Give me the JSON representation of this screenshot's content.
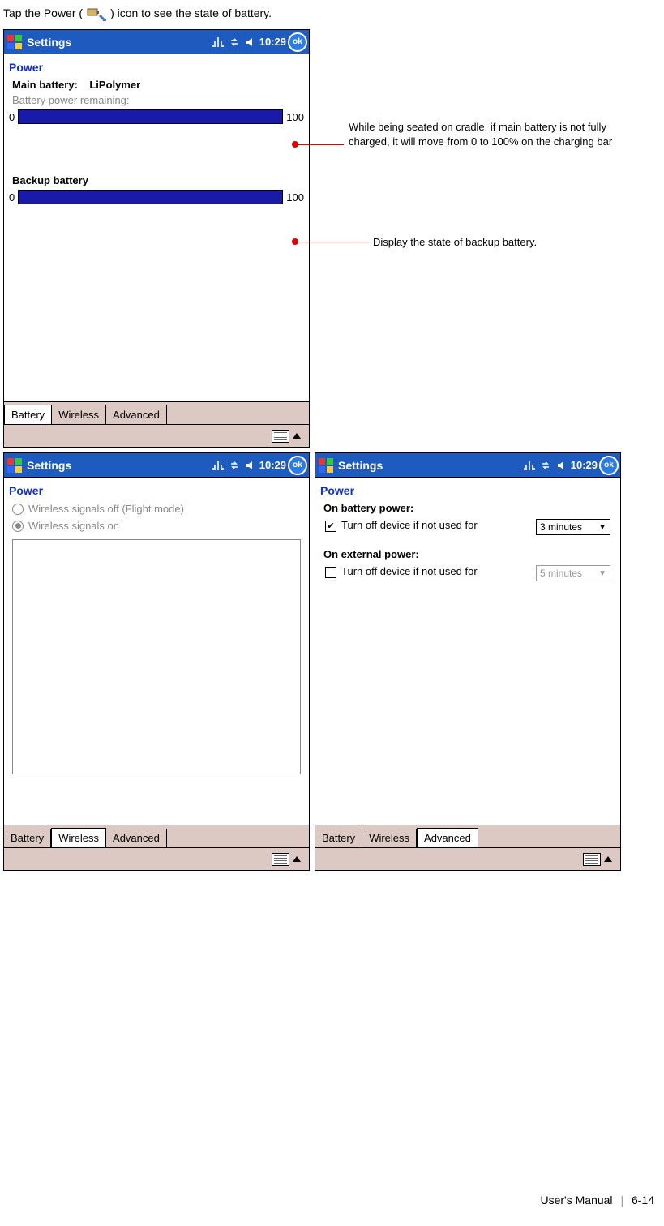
{
  "intro": {
    "pre": "Tap the Power (",
    "post": ") icon to see the state of battery."
  },
  "callouts": {
    "main": "While being seated on cradle, if main battery is not fully charged, it will move from 0 to 100% on the charging bar",
    "backup": "Display the state of backup battery."
  },
  "common": {
    "title": "Settings",
    "clock": "10:29",
    "ok": "ok",
    "section": "Power",
    "tabs": [
      "Battery",
      "Wireless",
      "Advanced"
    ]
  },
  "screenA": {
    "main_label": "Main battery:",
    "main_type": "LiPolymer",
    "remaining": "Battery power remaining:",
    "min": "0",
    "max": "100",
    "backup_label": "Backup battery",
    "active_tab": 0
  },
  "screenB": {
    "r1": "Wireless signals off (Flight mode)",
    "r2": "Wireless signals on",
    "active_tab": 1
  },
  "screenC": {
    "h1": "On battery power:",
    "opt1": "Turn off device if not used for",
    "sel1": "3 minutes",
    "h2": "On external power:",
    "opt2": "Turn off device if not used for",
    "sel2": "5 minutes",
    "active_tab": 2
  },
  "footer": {
    "book": "User's Manual",
    "page": "6-14"
  }
}
